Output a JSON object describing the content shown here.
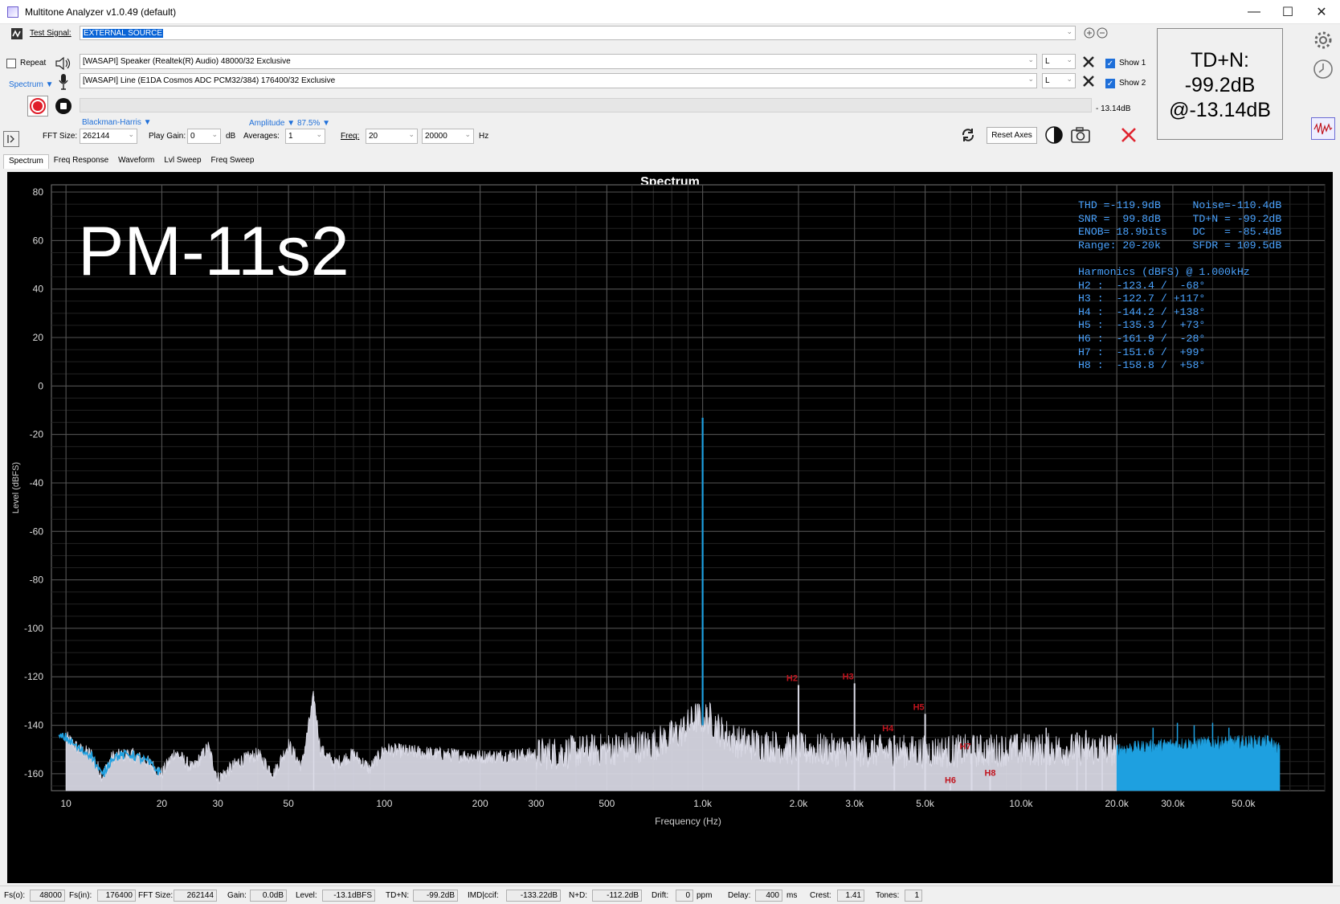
{
  "window": {
    "title": "Multitone Analyzer v1.0.49 (default)"
  },
  "test_signal": {
    "label": "Test Signal:",
    "value": "EXTERNAL SOURCE"
  },
  "output": {
    "repeat_label": "Repeat",
    "device": "[WASAPI] Speaker (Realtek(R) Audio) 48000/32 Exclusive",
    "channel": "L",
    "show_label": "Show 1",
    "show_checked": true
  },
  "input": {
    "mode_label": "Spectrum",
    "device": "[WASAPI] Line (E1DA Cosmos ADC PCM32/384) 176400/32 Exclusive",
    "channel": "L",
    "show_label": "Show 2",
    "show_checked": true
  },
  "level_meter": {
    "text": "- 13.14dB",
    "fill_fraction": 0
  },
  "settings": {
    "window_fn": "Blackman-Harris",
    "amplitude_label": "Amplitude",
    "amplitude_pct": "87.5%",
    "fft_size_label": "FFT Size:",
    "fft_size": "262144",
    "play_gain_label": "Play Gain:",
    "play_gain": "0",
    "play_gain_unit": "dB",
    "averages_label": "Averages:",
    "averages": "1",
    "freq_label": "Freq:",
    "freq_min": "20",
    "freq_max": "20000",
    "freq_unit": "Hz",
    "reset_axes": "Reset Axes"
  },
  "readout": {
    "line1": "TD+N:",
    "line2": "-99.2dB",
    "line3": "@-13.14dB"
  },
  "tabs": [
    "Spectrum",
    "Freq Response",
    "Waveform",
    "Lvl Sweep",
    "Freq Sweep"
  ],
  "active_tab": 0,
  "overlay_label": "PM-11s2",
  "stats_lines": [
    "THD =-119.9dB     Noise=-110.4dB",
    "SNR =  99.8dB     TD+N = -99.2dB",
    "ENOB= 18.9bits    DC   = -85.4dB",
    "Range: 20-20k     SFDR = 109.5dB",
    "",
    "Harmonics (dBFS) @ 1.000kHz",
    "H2 :  -123.4 /  -68°",
    "H3 :  -122.7 / +117°",
    "H4 :  -144.2 / +138°",
    "H5 :  -135.3 /  +73°",
    "H6 :  -161.9 /  -28°",
    "H7 :  -151.6 /  +99°",
    "H8 :  -158.8 /  +58°"
  ],
  "chart_data": {
    "type": "line",
    "title": "Spectrum",
    "xlabel": "Frequency (Hz)",
    "ylabel": "Level (dBFS)",
    "xscale": "log",
    "xlim": [
      9,
      90000
    ],
    "ylim": [
      -167,
      83
    ],
    "x_ticks": [
      10,
      20,
      30,
      50,
      100,
      200,
      300,
      500,
      1000,
      2000,
      3000,
      5000,
      10000,
      20000,
      30000,
      50000
    ],
    "x_tick_labels": [
      "10",
      "20",
      "30",
      "50",
      "100",
      "200",
      "300",
      "500",
      "1.0k",
      "2.0k",
      "3.0k",
      "5.0k",
      "10.0k",
      "20.0k",
      "30.0k",
      "50.0k"
    ],
    "y_ticks": [
      80,
      60,
      40,
      20,
      0,
      -20,
      -40,
      -60,
      -80,
      -100,
      -120,
      -140,
      -160
    ],
    "grid": true,
    "colors": {
      "series1": "#1ea0e0",
      "series2": "#dcdce8",
      "harmonic_label": "#c0141e"
    },
    "fundamental": {
      "x": 1000,
      "y": -13.1
    },
    "series": [
      {
        "name": "Show 1",
        "color": "#1ea0e0"
      },
      {
        "name": "Show 2",
        "color": "#dcdce8"
      }
    ],
    "noise_floor_points": [
      [
        10,
        -145
      ],
      [
        11,
        -150
      ],
      [
        12,
        -152
      ],
      [
        13,
        -161
      ],
      [
        14,
        -153
      ],
      [
        16,
        -152
      ],
      [
        18,
        -155
      ],
      [
        20,
        -160
      ],
      [
        22,
        -151
      ],
      [
        25,
        -158
      ],
      [
        28,
        -149
      ],
      [
        30,
        -162
      ],
      [
        35,
        -155
      ],
      [
        40,
        -152
      ],
      [
        45,
        -160
      ],
      [
        50,
        -148
      ],
      [
        55,
        -157
      ],
      [
        60,
        -128
      ],
      [
        63,
        -150
      ],
      [
        70,
        -156
      ],
      [
        80,
        -152
      ],
      [
        90,
        -158
      ],
      [
        100,
        -150
      ],
      [
        150,
        -152
      ],
      [
        200,
        -153
      ],
      [
        300,
        -152
      ],
      [
        500,
        -150
      ],
      [
        700,
        -148
      ],
      [
        850,
        -143
      ],
      [
        950,
        -137
      ],
      [
        1050,
        -137
      ],
      [
        1150,
        -143
      ],
      [
        1300,
        -147
      ],
      [
        2000,
        -150
      ],
      [
        5000,
        -151
      ],
      [
        10000,
        -150
      ],
      [
        20000,
        -150
      ],
      [
        30000,
        -148
      ],
      [
        50000,
        -147
      ],
      [
        60000,
        -147
      ],
      [
        65000,
        -150
      ]
    ],
    "harmonics": [
      {
        "name": "H2",
        "x": 2000,
        "y": -123.4
      },
      {
        "name": "H3",
        "x": 3000,
        "y": -122.7
      },
      {
        "name": "H4",
        "x": 4000,
        "y": -144.2
      },
      {
        "name": "H5",
        "x": 5000,
        "y": -135.3
      },
      {
        "name": "H6",
        "x": 6000,
        "y": -161.9
      },
      {
        "name": "H7",
        "x": 7000,
        "y": -151.6
      },
      {
        "name": "H8",
        "x": 8000,
        "y": -158.8
      }
    ],
    "spurs": [
      {
        "x": 60,
        "y": -128
      },
      {
        "x": 12000,
        "y": -141
      },
      {
        "x": 15000,
        "y": -143
      },
      {
        "x": 16000,
        "y": -142
      },
      {
        "x": 18000,
        "y": -144
      },
      {
        "x": 26000,
        "y": -141
      },
      {
        "x": 31000,
        "y": -139
      },
      {
        "x": 35000,
        "y": -140
      },
      {
        "x": 40000,
        "y": -139
      },
      {
        "x": 45000,
        "y": -141
      }
    ]
  },
  "status": {
    "fs_out_label": "Fs(o):",
    "fs_out": "48000",
    "fs_in_label": "Fs(in):",
    "fs_in": "176400",
    "fft_label": "FFT Size:",
    "fft": "262144",
    "gain_label": "Gain:",
    "gain": "0.0dB",
    "level_label": "Level:",
    "level": "-13.1dBFS",
    "tdn_label": "TD+N:",
    "tdn": "-99.2dB",
    "imd_label": "IMD|ccif:",
    "imd": "-133.22dB",
    "nd_label": "N+D:",
    "nd": "-112.2dB",
    "drift_label": "Drift:",
    "drift": "0",
    "drift_unit": "ppm",
    "delay_label": "Delay:",
    "delay": "400",
    "delay_unit": "ms",
    "crest_label": "Crest:",
    "crest": "1.41",
    "tones_label": "Tones:",
    "tones": "1"
  }
}
